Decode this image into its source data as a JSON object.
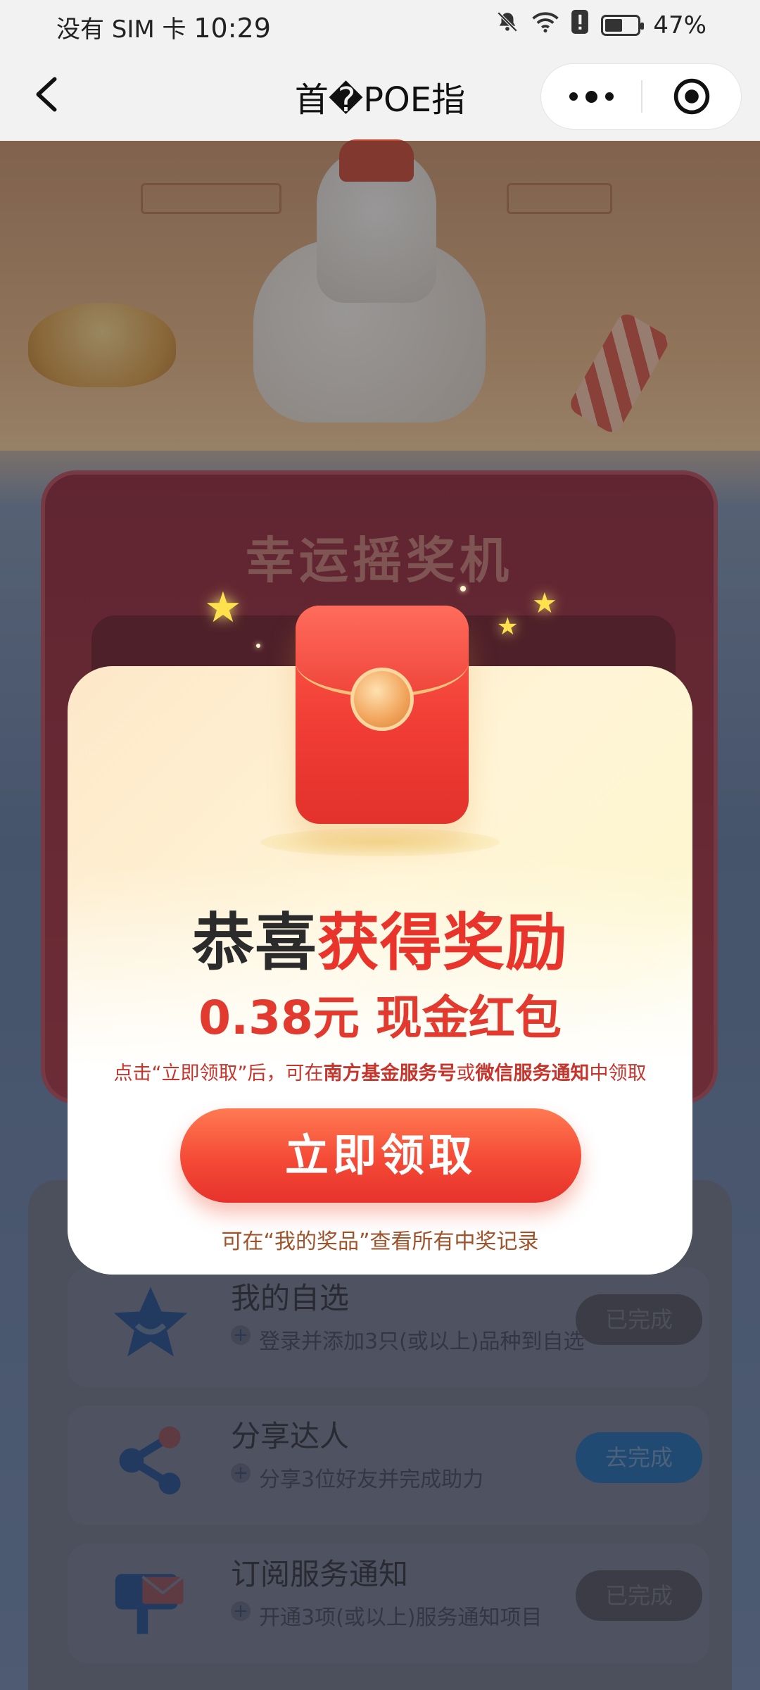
{
  "status_bar": {
    "carrier": "没有 SIM 卡",
    "time": "10:29",
    "battery": "47%",
    "battery_level": 0.47,
    "icons": [
      "bell-muted-icon",
      "wifi-icon",
      "alert-icon",
      "battery-icon"
    ]
  },
  "nav": {
    "title": "首�POE指",
    "back_icon": "chevron-left-icon",
    "more_icon": "more-dots-icon",
    "close_icon": "target-close-icon"
  },
  "background": {
    "machine_title": "幸运摇奖机",
    "tasks": [
      {
        "name": "我的自选",
        "desc": "登录并添加3只(或以上)品种到自选",
        "button": "已完成",
        "icon": "star-icon"
      },
      {
        "name": "分享达人",
        "desc": "分享3位好友并完成助力",
        "button": "去完成",
        "icon": "share-icon"
      },
      {
        "name": "订阅服务通知",
        "desc": "开通3项(或以上)服务通知项目",
        "button": "已完成",
        "icon": "mailbox-icon"
      }
    ]
  },
  "modal": {
    "headline_dark": "恭喜",
    "headline_red": "获得奖励",
    "amount": "0.38元 现金红包",
    "tip_1": "点击“立即领取”后，可在",
    "tip_2": "南方基金服务号",
    "tip_3": "或",
    "tip_4": "微信服务通知",
    "tip_5": "中领取",
    "claim_button": "立即领取",
    "records_note": "可在“我的奖品”查看所有中奖记录"
  },
  "colors": {
    "accent_red": "#e8342b",
    "headline_dark": "#2b2b2b",
    "note_brown": "#a0532a"
  }
}
